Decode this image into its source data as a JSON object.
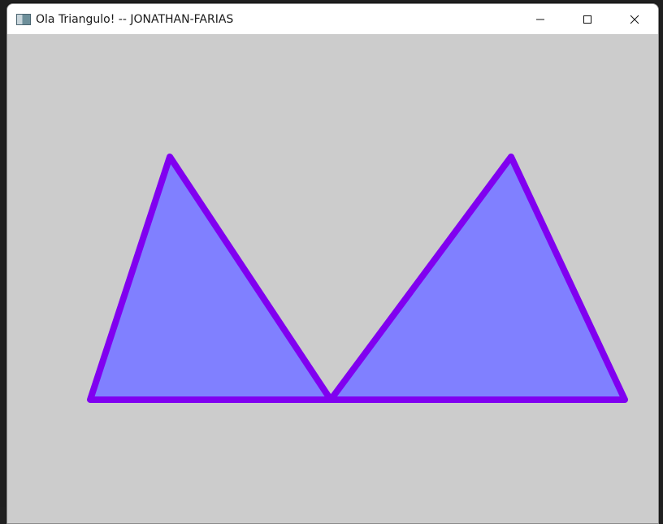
{
  "window": {
    "title": "Ola Triangulo! -- JONATHAN-FARIAS",
    "app_icon": "window-app-icon",
    "controls": {
      "minimize_icon": "minimize-icon",
      "maximize_icon": "maximize-icon",
      "close_icon": "close-icon"
    }
  },
  "canvas": {
    "background_color": "#cccccc",
    "fill_color": "#8080ff",
    "outline_color": "#8000f0",
    "triangles": [
      {
        "name": "left-triangle"
      },
      {
        "name": "right-triangle"
      }
    ]
  }
}
